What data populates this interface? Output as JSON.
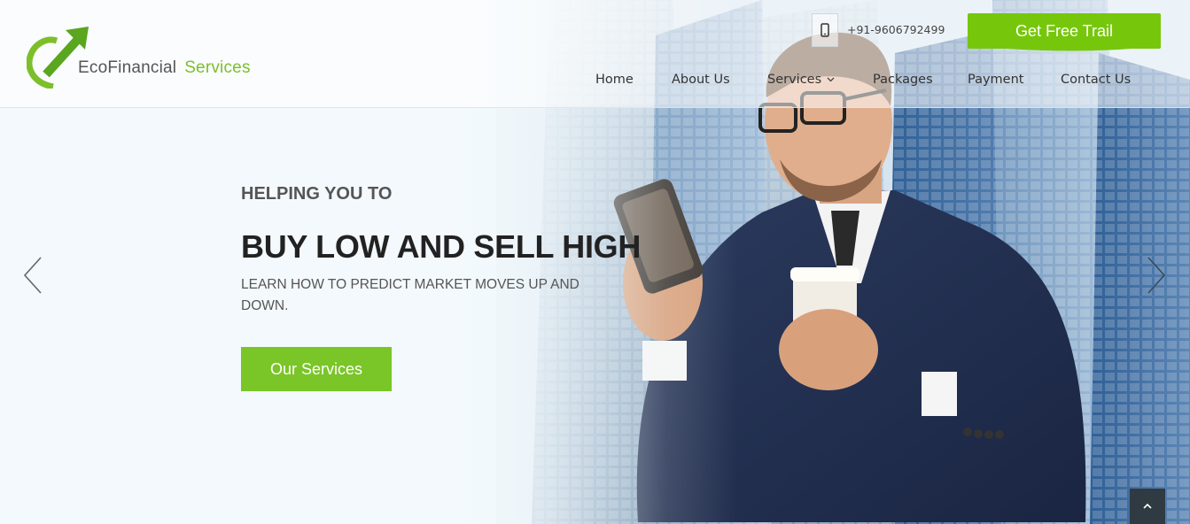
{
  "brand": {
    "name_part1": "EcoFinancial",
    "name_part2": "Services",
    "accent_color": "#7cbf2a",
    "icon": "rising-arrow-logo-icon"
  },
  "header": {
    "phone_icon": "mobile-phone-icon",
    "phone": "+91-9606792499",
    "cta_label": "Get Free Trail",
    "cta_color": "#76c70b"
  },
  "nav": {
    "items": [
      {
        "label": "Home"
      },
      {
        "label": "About Us"
      },
      {
        "label": "Services",
        "icon": "chevron-down-icon"
      },
      {
        "label": "Packages"
      },
      {
        "label": "Payment"
      },
      {
        "label": "Contact Us"
      }
    ]
  },
  "hero": {
    "kicker": "HELPING YOU TO",
    "headline": "BUY LOW AND SELL HIGH",
    "subline": "LEARN HOW TO PREDICT MARKET MOVES UP AND DOWN.",
    "button_label": "Our Services",
    "prev_icon": "chevron-left-icon",
    "next_icon": "chevron-right-icon"
  },
  "footer_controls": {
    "scroll_top_icon": "chevron-up-icon"
  }
}
